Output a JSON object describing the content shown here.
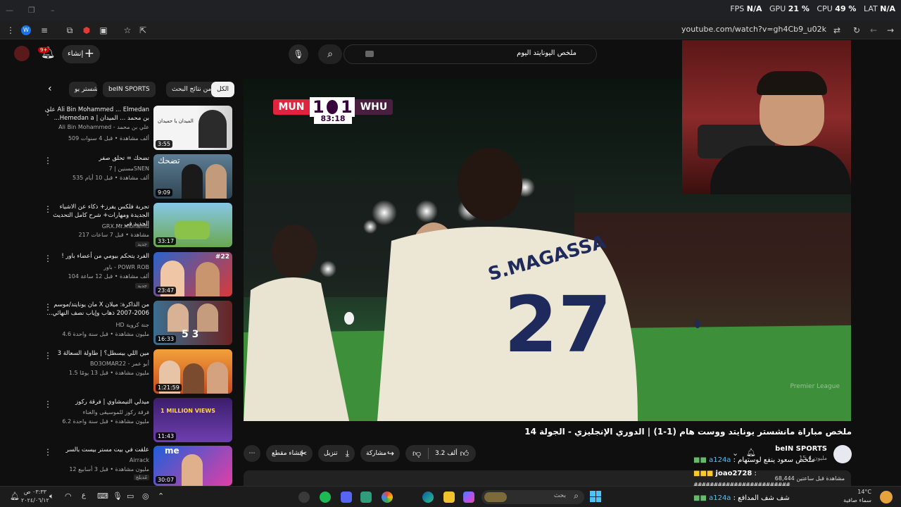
{
  "system": {
    "perf_fps_label": "FPS",
    "perf_fps": "N/A",
    "perf_gpu_label": "GPU",
    "perf_gpu": "21 %",
    "perf_cpu_label": "CPU",
    "perf_cpu": "49 %",
    "perf_lat_label": "LAT",
    "perf_lat": "N/A"
  },
  "browser": {
    "url": "youtube.com/watch?v=gh4Cb9_u02k"
  },
  "header": {
    "create_label": "إنشاء",
    "notification_count": "9+",
    "search_value": "ملخص اليونايتد اليوم"
  },
  "chips": [
    "الكل",
    "من نتائج البحث",
    "beIN SPORTS",
    "مانشستر يو"
  ],
  "recommendations": [
    {
      "title": "Ali Bin Mohammed ... Elmedan على بن محمد ... الميدان | Hemedan a...",
      "channel": "Ali Bin Mohammed - علي بن محمد",
      "meta": "509 ألف مشاهدة • قبل 4 سنوات",
      "duration": "3:55",
      "thumb_text": "الميدان يا حميدان"
    },
    {
      "title": "تضحك = تحلق صفر",
      "channel": "مسنين | 7SNEN",
      "meta": "535 ألف مشاهدة • قبل 10 أيام",
      "duration": "9:09",
      "thumb_text": "تضحك"
    },
    {
      "title": "تجربة فلكس يفرز+ ذكاء عن الاشياء الجديدة ومهارات+ شرح كامل التحديث الجديد في ...",
      "channel": "GRX.Mr.mohamd",
      "meta": "217 مشاهدة • قبل 7 ساعات",
      "duration": "33:17",
      "badge": "جديد"
    },
    {
      "title": "الفرد يتحكم بيومي من أعضاء باور !",
      "channel": "باور - POWR ROB",
      "meta": "104 ألف مشاهدة • قبل 12 ساعة",
      "duration": "23:47",
      "badge": "جديد",
      "thumb_text": "#22"
    },
    {
      "title": "من الذاكرة: ميلان X مان يونايتد/موسم 2006-2007 ذهاب وإياب نصف النهائي...",
      "channel": "HD جنة كروية",
      "meta": "4.6 مليون مشاهدة • قبل سنة واحدة",
      "duration": "16:33",
      "thumb_text": "5 3"
    },
    {
      "title": "مين اللي بيسطل؟ | طاولة السعالة 3",
      "channel": "BO3OMAR22 - أبو عمر",
      "meta": "1.5 مليون مشاهدة • قبل 13 يومًا",
      "duration": "1:21:59"
    },
    {
      "title": "ميدلي التيمشاوي | فرقة ركوز",
      "channel": "فرقة ركوز للموسيقى والغناء",
      "meta": "6.2 مليون مشاهدة • قبل سنة واحدة",
      "duration": "11:43",
      "thumb_text": "1 MILLION VIEWS"
    },
    {
      "title": "علقت في بيت مستر بيست بالسر",
      "channel": "Airrack",
      "meta": "12 مليون مشاهدة • قبل 3 أسابيع",
      "duration": "30:07",
      "badge": "مُدبلج",
      "thumb_text": "me"
    }
  ],
  "video": {
    "title": "ملخص مباراة مانشستر يونايتد ووست هام (1-1) | الدوري الإنجليزي - الجولة 14",
    "score_home": "MUN",
    "score_home_goals": "1",
    "score_away_goals": "1",
    "score_away": "WHU",
    "clock": "83:18",
    "jersey_name": "S.MAGASSA",
    "jersey_number": "27",
    "watermark": "Premier League",
    "channel": "beIN SPORTS",
    "subscribers": "15.4 مليون",
    "likes": "3.2 ألف",
    "share_label": "مشاركة",
    "download_label": "تنزيل",
    "clip_label": "إنشاء مقطع",
    "views": "68,444 مشاهدة قبل ساعتين"
  },
  "chat": [
    {
      "user": "a124a",
      "msg": "ملخص سعود ينفع لوستهام"
    },
    {
      "user": "joao2728",
      "msg": ""
    },
    {
      "user": "",
      "msg": "########################"
    },
    {
      "user": "a124a",
      "msg": "شف شف المدافع"
    }
  ],
  "taskbar": {
    "time": "٠٣:٣٣ ص",
    "date": "٢٠٢٤/٠٦/١٢",
    "search_placeholder": "بحث",
    "weather_temp": "14°C",
    "weather_desc": "سماء صافية",
    "lang": "ع"
  }
}
